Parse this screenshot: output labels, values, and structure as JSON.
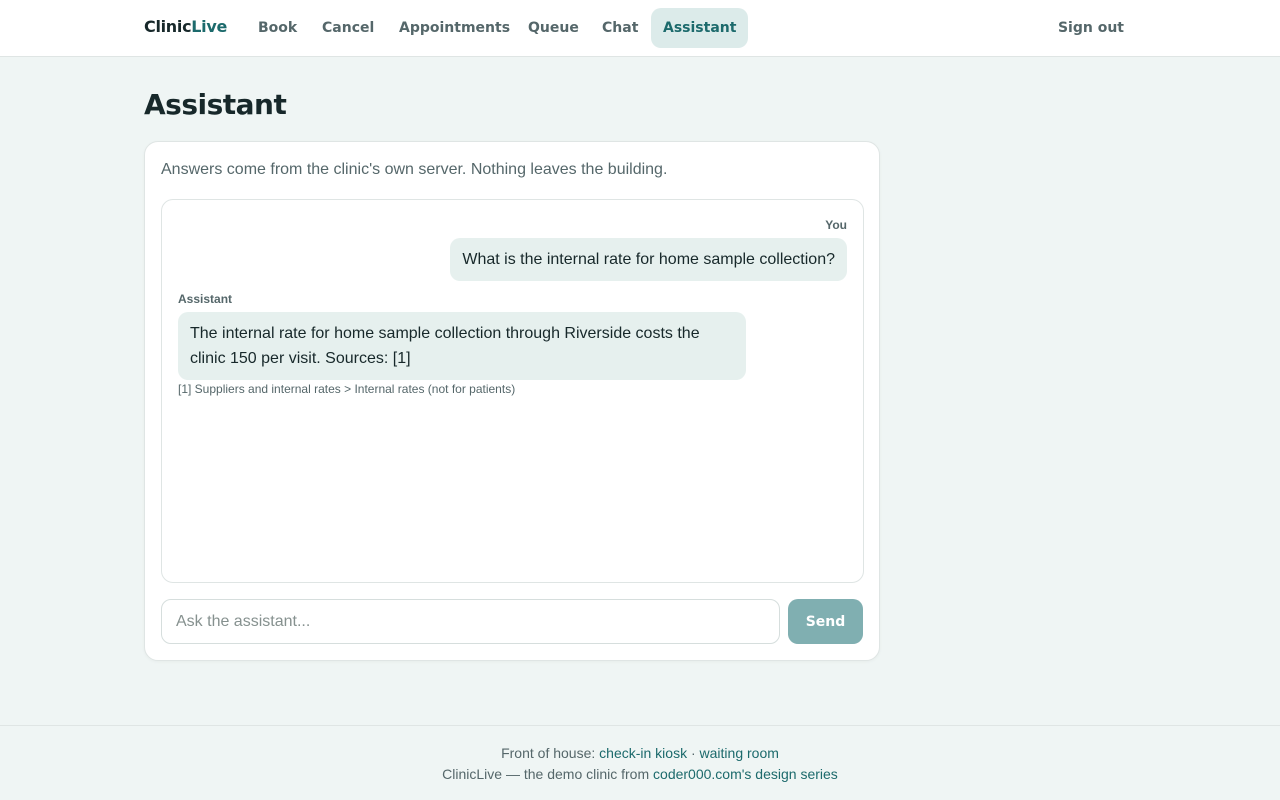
{
  "brand": {
    "part1": "Clinic",
    "part2": "Live"
  },
  "nav": {
    "items": [
      {
        "label": "Book"
      },
      {
        "label": "Cancel"
      },
      {
        "label": "Appointments"
      },
      {
        "label": "Queue"
      },
      {
        "label": "Chat"
      },
      {
        "label": "Assistant",
        "active": true
      }
    ],
    "sign_out": "Sign out"
  },
  "page": {
    "title": "Assistant"
  },
  "assistant": {
    "note": "Answers come from the clinic's own server. Nothing leaves the building.",
    "messages": [
      {
        "role": "user",
        "author": "You",
        "text": "What is the internal rate for home sample collection?"
      },
      {
        "role": "assistant",
        "author": "Assistant",
        "text": "The internal rate for home sample collection through Riverside costs the clinic 150 per visit. Sources: [1]"
      }
    ],
    "sources_note": "[1] Suppliers and internal rates > Internal rates (not for patients)",
    "input": {
      "placeholder": "Ask the assistant...",
      "value": ""
    },
    "send_label": "Send"
  },
  "footer": {
    "line1_prefix": "Front of house: ",
    "link_kiosk": "check-in kiosk",
    "separator": " · ",
    "link_waiting": "waiting room",
    "line2_prefix": "ClinicLive — the demo clinic from ",
    "link_design": "coder000.com's design series"
  },
  "colors": {
    "accent": "#1c6a6c",
    "page_bg": "#eff5f4",
    "bubble_bg": "#e6f0ee",
    "send_button": "#80afb1",
    "active_tab_bg": "#dcebea"
  }
}
